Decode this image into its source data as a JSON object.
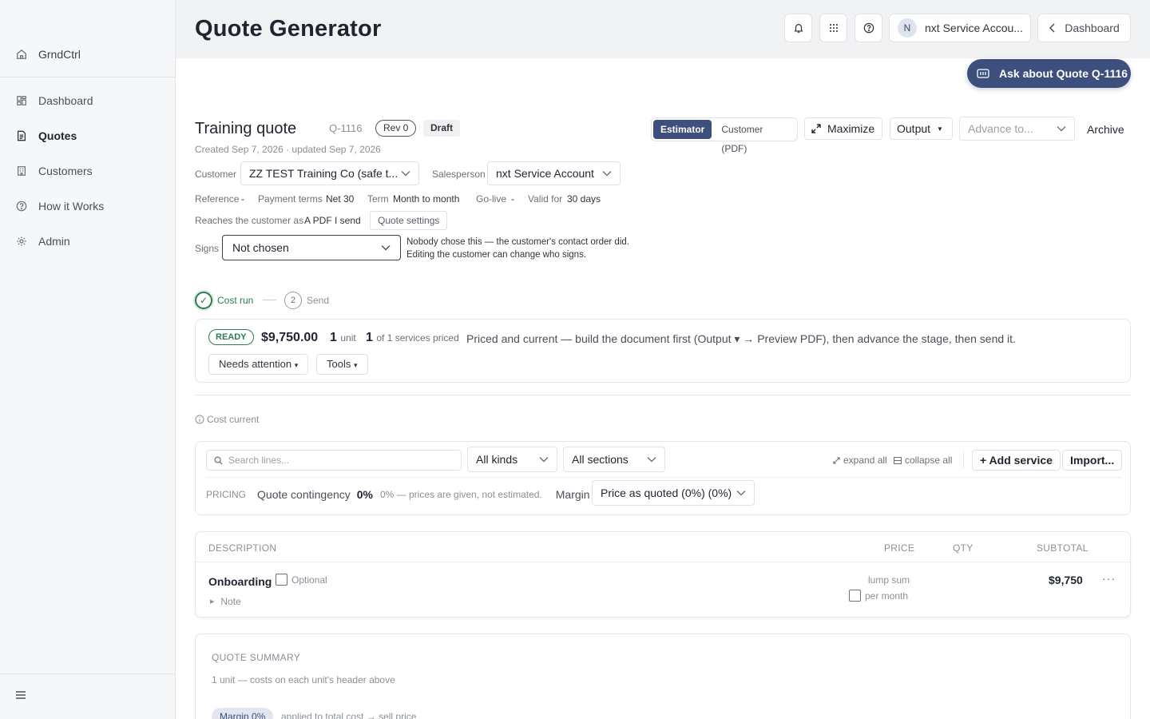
{
  "sidebar": {
    "brand": "GrndCtrl",
    "items": [
      {
        "label": "Dashboard"
      },
      {
        "label": "Quotes"
      },
      {
        "label": "Customers"
      },
      {
        "label": "How it Works"
      },
      {
        "label": "Admin"
      }
    ]
  },
  "header": {
    "title": "Quote Generator",
    "account": "nxt Service Accou...",
    "avatar_initial": "N",
    "dashboard_button": "Dashboard",
    "ask_button": "Ask about Quote Q-1116"
  },
  "quote": {
    "title": "Training quote",
    "number": "Q-1116",
    "revision": "Rev 0",
    "status": "Draft",
    "created": "Created Sep 7, 2026 · updated Sep 7, 2026",
    "view_estimator": "Estimator",
    "view_customer": "Customer (PDF)",
    "maximize": "Maximize",
    "output": "Output",
    "advance_placeholder": "Advance to...",
    "archive": "Archive"
  },
  "fields": {
    "customer_label": "Customer",
    "customer_value": "ZZ TEST Training Co (safe t...",
    "salesperson_label": "Salesperson",
    "salesperson_value": "nxt Service Account",
    "reference_label": "Reference",
    "reference_value": "-",
    "payment_label": "Payment terms",
    "payment_value": "Net 30",
    "term_label": "Term",
    "term_value": "Month to month",
    "golive_label": "Go-live",
    "golive_value": "-",
    "valid_label": "Valid for",
    "valid_value": "30 days",
    "reaches_label": "Reaches the customer as",
    "reaches_value": "A PDF I send",
    "quote_settings": "Quote settings",
    "signs_label": "Signs",
    "signs_value": "Not chosen",
    "signs_note": "Nobody chose this — the customer's contact order did. Editing the customer can change who signs."
  },
  "stepper": {
    "step1": "Cost run",
    "step2_num": "2",
    "step2": "Send"
  },
  "status": {
    "badge": "READY",
    "total": "$9,750.00",
    "units_num": "1",
    "units_label": "unit",
    "priced_num": "1",
    "priced_label": "of 1 services priced",
    "message": "Priced and current — build the document first (Output ▾ → Preview PDF), then advance the stage, then send it.",
    "needs_attention": "Needs attention",
    "tools": "Tools"
  },
  "cost_current": "Cost current",
  "toolbar": {
    "search_placeholder": "Search lines...",
    "kinds": "All kinds",
    "sections": "All sections",
    "expand_all": "expand all",
    "collapse_all": "collapse all",
    "add_service": "+ Add service",
    "import": "Import..."
  },
  "pricing": {
    "label": "PRICING",
    "contingency_label": "Quote contingency",
    "contingency_value": "0%",
    "contingency_note": "0% — prices are given, not estimated.",
    "margin_label": "Margin",
    "margin_value": "Price as quoted (0%) (0%)"
  },
  "lines": {
    "headers": {
      "description": "DESCRIPTION",
      "price": "PRICE",
      "qty": "QTY",
      "subtotal": "SUBTOTAL"
    },
    "rows": [
      {
        "name": "Onboarding",
        "optional": "Optional",
        "note": "Note",
        "price_type": "lump sum",
        "per_month": "per month",
        "subtotal": "$9,750"
      }
    ]
  },
  "summary": {
    "title": "QUOTE SUMMARY",
    "units_note": "1 unit — costs on each unit's header above",
    "margin_chip": "Margin 0%",
    "margin_note": "applied to total cost → sell price"
  }
}
